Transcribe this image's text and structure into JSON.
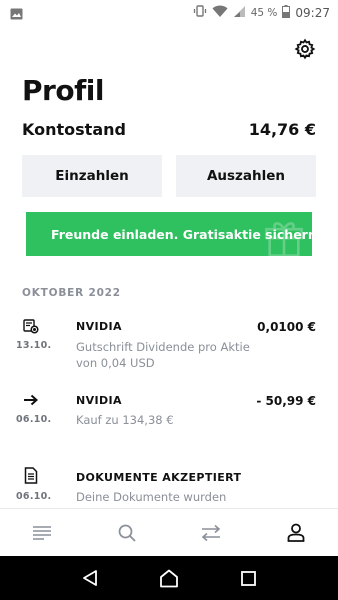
{
  "status_bar": {
    "battery_percent": "45 %",
    "time": "09:27"
  },
  "page": {
    "title": "Profil"
  },
  "balance": {
    "label": "Kontostand",
    "value": "14,76 €"
  },
  "actions": {
    "deposit_label": "Einzahlen",
    "withdraw_label": "Auszahlen"
  },
  "invite": {
    "text": "Freunde einladen. Gratisaktie sichern.",
    "color": "#2fc05f"
  },
  "timeline": {
    "month": "OKTOBER 2022",
    "items": [
      {
        "icon": "dividend-coins-icon",
        "date": "13.10.",
        "name": "NVIDIA",
        "amount": "0,0100 €",
        "desc": "Gutschrift Dividende pro Aktie von 0,04 USD"
      },
      {
        "icon": "arrow-right-icon",
        "date": "06.10.",
        "name": "NVIDIA",
        "amount": "- 50,99 €",
        "desc": "Kauf zu 134,38 €"
      },
      {
        "icon": "document-icon",
        "date": "06.10.",
        "name": "DOKUMENTE AKZEPTIERT",
        "amount": "",
        "desc": "Deine Dokumente wurden"
      }
    ]
  },
  "bottom_nav": {
    "items": [
      "feed-icon",
      "search-icon",
      "transfer-icon",
      "profile-icon"
    ],
    "active": "profile-icon"
  }
}
